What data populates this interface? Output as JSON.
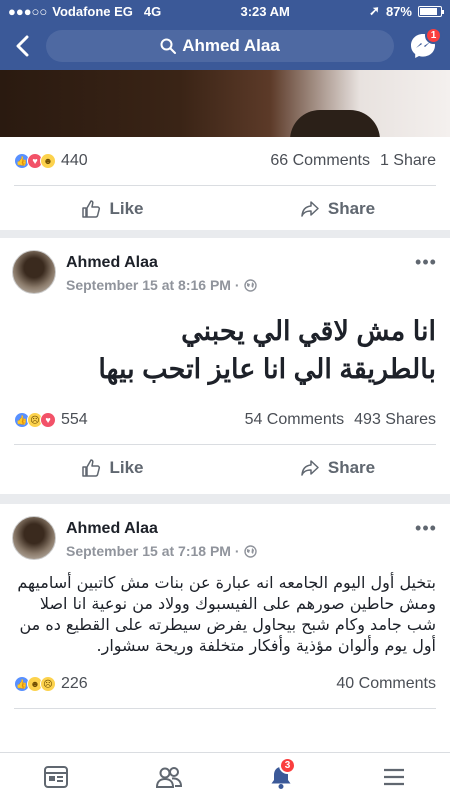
{
  "status_bar": {
    "carrier": "Vodafone EG",
    "network": "4G",
    "time": "3:23 AM",
    "battery": "87%",
    "battery_level": 0.87
  },
  "header": {
    "search_text": "Ahmed Alaa",
    "messenger_badge": "1"
  },
  "post1": {
    "reaction_count": "440",
    "comments": "66 Comments",
    "shares": "1 Share",
    "like_label": "Like",
    "share_label": "Share"
  },
  "post2": {
    "author": "Ahmed Alaa",
    "timestamp": "September 15 at 8:16 PM · ",
    "text_line1": "انا مش لاقي الي يحبني",
    "text_line2": "بالطريقة الي انا عايز اتحب بيها",
    "reaction_count": "554",
    "comments": "54 Comments",
    "shares": "493 Shares",
    "like_label": "Like",
    "share_label": "Share"
  },
  "post3": {
    "author": "Ahmed Alaa",
    "timestamp": "September 15 at 7:18 PM · ",
    "text": "بتخيل أول اليوم الجامعه انه عبارة عن بنات مش كاتبين أساميهم ومش حاطين صورهم على الفيسبوك وولاد من نوعية انا اصلا شب جامد وكام شبح بيحاول يفرض سيطرته على القطيع ده من أول يوم وألوان مؤذية وأفكار متخلفة وريحة سشوار.",
    "reaction_count": "226",
    "comments": "40 Comments"
  },
  "tabbar": {
    "notifications_badge": "3"
  },
  "colors": {
    "brand": "#3b5998",
    "badge": "#fa3e3e",
    "text_secondary": "#90949c"
  }
}
